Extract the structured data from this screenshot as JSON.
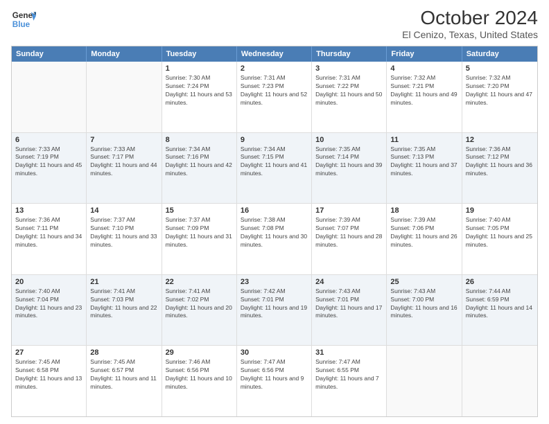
{
  "header": {
    "logo_line1": "General",
    "logo_line2": "Blue",
    "title": "October 2024",
    "subtitle": "El Cenizo, Texas, United States"
  },
  "days_of_week": [
    "Sunday",
    "Monday",
    "Tuesday",
    "Wednesday",
    "Thursday",
    "Friday",
    "Saturday"
  ],
  "weeks": [
    [
      {
        "day": "",
        "sunrise": "",
        "sunset": "",
        "daylight": "",
        "empty": true
      },
      {
        "day": "",
        "sunrise": "",
        "sunset": "",
        "daylight": "",
        "empty": true
      },
      {
        "day": "1",
        "sunrise": "Sunrise: 7:30 AM",
        "sunset": "Sunset: 7:24 PM",
        "daylight": "Daylight: 11 hours and 53 minutes."
      },
      {
        "day": "2",
        "sunrise": "Sunrise: 7:31 AM",
        "sunset": "Sunset: 7:23 PM",
        "daylight": "Daylight: 11 hours and 52 minutes."
      },
      {
        "day": "3",
        "sunrise": "Sunrise: 7:31 AM",
        "sunset": "Sunset: 7:22 PM",
        "daylight": "Daylight: 11 hours and 50 minutes."
      },
      {
        "day": "4",
        "sunrise": "Sunrise: 7:32 AM",
        "sunset": "Sunset: 7:21 PM",
        "daylight": "Daylight: 11 hours and 49 minutes."
      },
      {
        "day": "5",
        "sunrise": "Sunrise: 7:32 AM",
        "sunset": "Sunset: 7:20 PM",
        "daylight": "Daylight: 11 hours and 47 minutes."
      }
    ],
    [
      {
        "day": "6",
        "sunrise": "Sunrise: 7:33 AM",
        "sunset": "Sunset: 7:19 PM",
        "daylight": "Daylight: 11 hours and 45 minutes."
      },
      {
        "day": "7",
        "sunrise": "Sunrise: 7:33 AM",
        "sunset": "Sunset: 7:17 PM",
        "daylight": "Daylight: 11 hours and 44 minutes."
      },
      {
        "day": "8",
        "sunrise": "Sunrise: 7:34 AM",
        "sunset": "Sunset: 7:16 PM",
        "daylight": "Daylight: 11 hours and 42 minutes."
      },
      {
        "day": "9",
        "sunrise": "Sunrise: 7:34 AM",
        "sunset": "Sunset: 7:15 PM",
        "daylight": "Daylight: 11 hours and 41 minutes."
      },
      {
        "day": "10",
        "sunrise": "Sunrise: 7:35 AM",
        "sunset": "Sunset: 7:14 PM",
        "daylight": "Daylight: 11 hours and 39 minutes."
      },
      {
        "day": "11",
        "sunrise": "Sunrise: 7:35 AM",
        "sunset": "Sunset: 7:13 PM",
        "daylight": "Daylight: 11 hours and 37 minutes."
      },
      {
        "day": "12",
        "sunrise": "Sunrise: 7:36 AM",
        "sunset": "Sunset: 7:12 PM",
        "daylight": "Daylight: 11 hours and 36 minutes."
      }
    ],
    [
      {
        "day": "13",
        "sunrise": "Sunrise: 7:36 AM",
        "sunset": "Sunset: 7:11 PM",
        "daylight": "Daylight: 11 hours and 34 minutes."
      },
      {
        "day": "14",
        "sunrise": "Sunrise: 7:37 AM",
        "sunset": "Sunset: 7:10 PM",
        "daylight": "Daylight: 11 hours and 33 minutes."
      },
      {
        "day": "15",
        "sunrise": "Sunrise: 7:37 AM",
        "sunset": "Sunset: 7:09 PM",
        "daylight": "Daylight: 11 hours and 31 minutes."
      },
      {
        "day": "16",
        "sunrise": "Sunrise: 7:38 AM",
        "sunset": "Sunset: 7:08 PM",
        "daylight": "Daylight: 11 hours and 30 minutes."
      },
      {
        "day": "17",
        "sunrise": "Sunrise: 7:39 AM",
        "sunset": "Sunset: 7:07 PM",
        "daylight": "Daylight: 11 hours and 28 minutes."
      },
      {
        "day": "18",
        "sunrise": "Sunrise: 7:39 AM",
        "sunset": "Sunset: 7:06 PM",
        "daylight": "Daylight: 11 hours and 26 minutes."
      },
      {
        "day": "19",
        "sunrise": "Sunrise: 7:40 AM",
        "sunset": "Sunset: 7:05 PM",
        "daylight": "Daylight: 11 hours and 25 minutes."
      }
    ],
    [
      {
        "day": "20",
        "sunrise": "Sunrise: 7:40 AM",
        "sunset": "Sunset: 7:04 PM",
        "daylight": "Daylight: 11 hours and 23 minutes."
      },
      {
        "day": "21",
        "sunrise": "Sunrise: 7:41 AM",
        "sunset": "Sunset: 7:03 PM",
        "daylight": "Daylight: 11 hours and 22 minutes."
      },
      {
        "day": "22",
        "sunrise": "Sunrise: 7:41 AM",
        "sunset": "Sunset: 7:02 PM",
        "daylight": "Daylight: 11 hours and 20 minutes."
      },
      {
        "day": "23",
        "sunrise": "Sunrise: 7:42 AM",
        "sunset": "Sunset: 7:01 PM",
        "daylight": "Daylight: 11 hours and 19 minutes."
      },
      {
        "day": "24",
        "sunrise": "Sunrise: 7:43 AM",
        "sunset": "Sunset: 7:01 PM",
        "daylight": "Daylight: 11 hours and 17 minutes."
      },
      {
        "day": "25",
        "sunrise": "Sunrise: 7:43 AM",
        "sunset": "Sunset: 7:00 PM",
        "daylight": "Daylight: 11 hours and 16 minutes."
      },
      {
        "day": "26",
        "sunrise": "Sunrise: 7:44 AM",
        "sunset": "Sunset: 6:59 PM",
        "daylight": "Daylight: 11 hours and 14 minutes."
      }
    ],
    [
      {
        "day": "27",
        "sunrise": "Sunrise: 7:45 AM",
        "sunset": "Sunset: 6:58 PM",
        "daylight": "Daylight: 11 hours and 13 minutes."
      },
      {
        "day": "28",
        "sunrise": "Sunrise: 7:45 AM",
        "sunset": "Sunset: 6:57 PM",
        "daylight": "Daylight: 11 hours and 11 minutes."
      },
      {
        "day": "29",
        "sunrise": "Sunrise: 7:46 AM",
        "sunset": "Sunset: 6:56 PM",
        "daylight": "Daylight: 11 hours and 10 minutes."
      },
      {
        "day": "30",
        "sunrise": "Sunrise: 7:47 AM",
        "sunset": "Sunset: 6:56 PM",
        "daylight": "Daylight: 11 hours and 9 minutes."
      },
      {
        "day": "31",
        "sunrise": "Sunrise: 7:47 AM",
        "sunset": "Sunset: 6:55 PM",
        "daylight": "Daylight: 11 hours and 7 minutes."
      },
      {
        "day": "",
        "sunrise": "",
        "sunset": "",
        "daylight": "",
        "empty": true
      },
      {
        "day": "",
        "sunrise": "",
        "sunset": "",
        "daylight": "",
        "empty": true
      }
    ]
  ]
}
